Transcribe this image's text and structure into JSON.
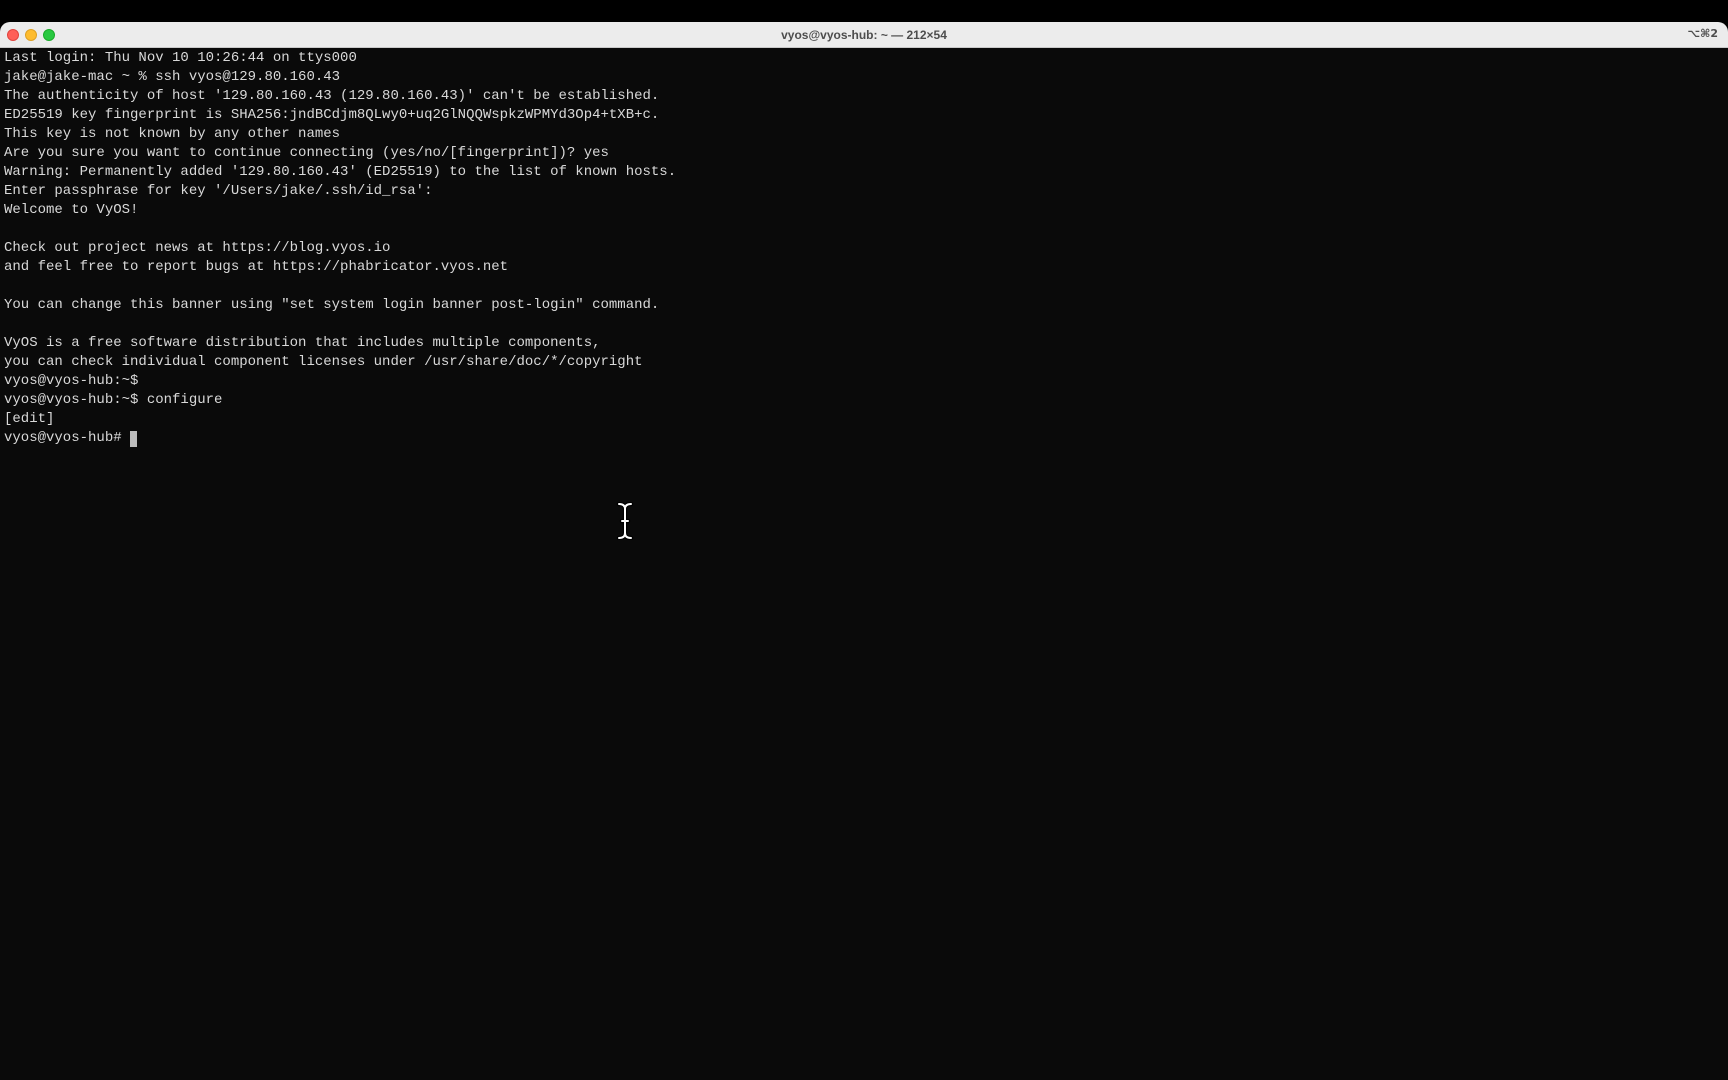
{
  "window": {
    "title": "vyos@vyos-hub: ~ — 212×54",
    "shortcut": "⌥⌘2"
  },
  "icons": {
    "close": "close-button-icon",
    "minimize": "minimize-button-icon",
    "zoom": "zoom-button-icon",
    "mouse_cursor": "ibeam-cursor-icon"
  },
  "colors": {
    "background": "#0a0a0a",
    "text": "#d9d9d9",
    "titlebar": "#ececec"
  },
  "terminal": {
    "lines": [
      "Last login: Thu Nov 10 10:26:44 on ttys000",
      "jake@jake-mac ~ % ssh vyos@129.80.160.43",
      "The authenticity of host '129.80.160.43 (129.80.160.43)' can't be established.",
      "ED25519 key fingerprint is SHA256:jndBCdjm8QLwy0+uq2GlNQQWspkzWPMYd3Op4+tXB+c.",
      "This key is not known by any other names",
      "Are you sure you want to continue connecting (yes/no/[fingerprint])? yes",
      "Warning: Permanently added '129.80.160.43' (ED25519) to the list of known hosts.",
      "Enter passphrase for key '/Users/jake/.ssh/id_rsa':",
      "Welcome to VyOS!",
      "",
      "Check out project news at https://blog.vyos.io",
      "and feel free to report bugs at https://phabricator.vyos.net",
      "",
      "You can change this banner using \"set system login banner post-login\" command.",
      "",
      "VyOS is a free software distribution that includes multiple components,",
      "you can check individual component licenses under /usr/share/doc/*/copyright",
      "vyos@vyos-hub:~$",
      "vyos@vyos-hub:~$ configure",
      "[edit]"
    ],
    "prompt": "vyos@vyos-hub#"
  }
}
